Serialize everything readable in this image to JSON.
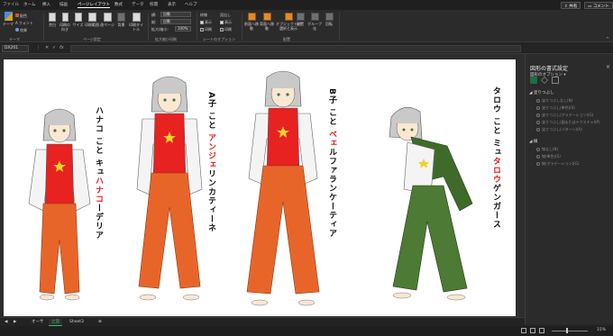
{
  "menu": {
    "items": [
      "ファイル",
      "ホーム",
      "挿入",
      "描画",
      "ページレイアウト",
      "数式",
      "データ",
      "校閲",
      "表示",
      "ヘルプ"
    ],
    "active_index": 4,
    "share": "共有",
    "comment": "コメント"
  },
  "ribbon": {
    "theme": {
      "label": "テーマ",
      "group": "テーマ",
      "colors": "配色",
      "fonts": "フォント",
      "effects": "効果"
    },
    "page_setup": {
      "group": "ページ設定",
      "buttons": [
        "余白",
        "印刷の向き",
        "サイズ",
        "印刷範囲",
        "改ページ",
        "背景",
        "印刷タイトル"
      ]
    },
    "scale": {
      "group": "拡大縮小印刷",
      "width_label": "横:",
      "width_value": "自動",
      "height_label": "縦:",
      "height_value": "自動",
      "zoom_label": "拡大/縮小:",
      "zoom_value": "100%"
    },
    "sheet_options": {
      "group": "シートのオプション",
      "gridlines": "枠線",
      "headings": "見出し",
      "view": "表示",
      "print": "印刷"
    },
    "arrange": {
      "group": "配置",
      "buttons": [
        "前面へ移動",
        "背面へ移動",
        "オブジェクトの選択と表示",
        "配置",
        "グループ化",
        "回転"
      ]
    }
  },
  "formula_bar": {
    "name_box": "DX201",
    "fx": "fx"
  },
  "characters": [
    {
      "label_parts": [
        {
          "t": "ハナコ こと キュ"
        },
        {
          "t": "ハナコ",
          "red": true
        },
        {
          "t": "ーデリア"
        }
      ]
    },
    {
      "label_parts": [
        {
          "t": "A子 こと "
        },
        {
          "t": "アンジェ",
          "red": true
        },
        {
          "t": "リンカティーネ"
        }
      ]
    },
    {
      "label_parts": [
        {
          "t": "B子 こと "
        },
        {
          "t": "ベェ",
          "red": true
        },
        {
          "t": "ルファランケーティア"
        }
      ]
    },
    {
      "label_parts": [
        {
          "t": "タロウ こと ミュ"
        },
        {
          "t": "タロウ",
          "red": true
        },
        {
          "t": "ゲンガース"
        }
      ]
    }
  ],
  "panel": {
    "title": "図形の書式設定",
    "close": "×",
    "dropdown": "図形のオプション ▾",
    "sections": [
      {
        "title": "塗りつぶし",
        "options": [
          "塗りつぶしなし(N)",
          "塗りつぶし(単色)(S)",
          "塗りつぶし(グラデーション)(G)",
          "塗りつぶし(図またはテクスチャ)(P)",
          "塗りつぶし(パターン)(A)"
        ]
      },
      {
        "title": "線",
        "options": [
          "線なし(N)",
          "線(単色)(S)",
          "線(グラデーション)(G)"
        ]
      }
    ]
  },
  "sheets": {
    "tabs": [
      "オーサ",
      "立面",
      "Sheet3"
    ],
    "active_index": 1,
    "add": "⊕"
  },
  "status": {
    "zoom": "15%"
  },
  "colors": {
    "accent": "#1d6f42",
    "red_text": "#e31b1b",
    "orange": "#e8652a",
    "green": "#4d7a34"
  }
}
